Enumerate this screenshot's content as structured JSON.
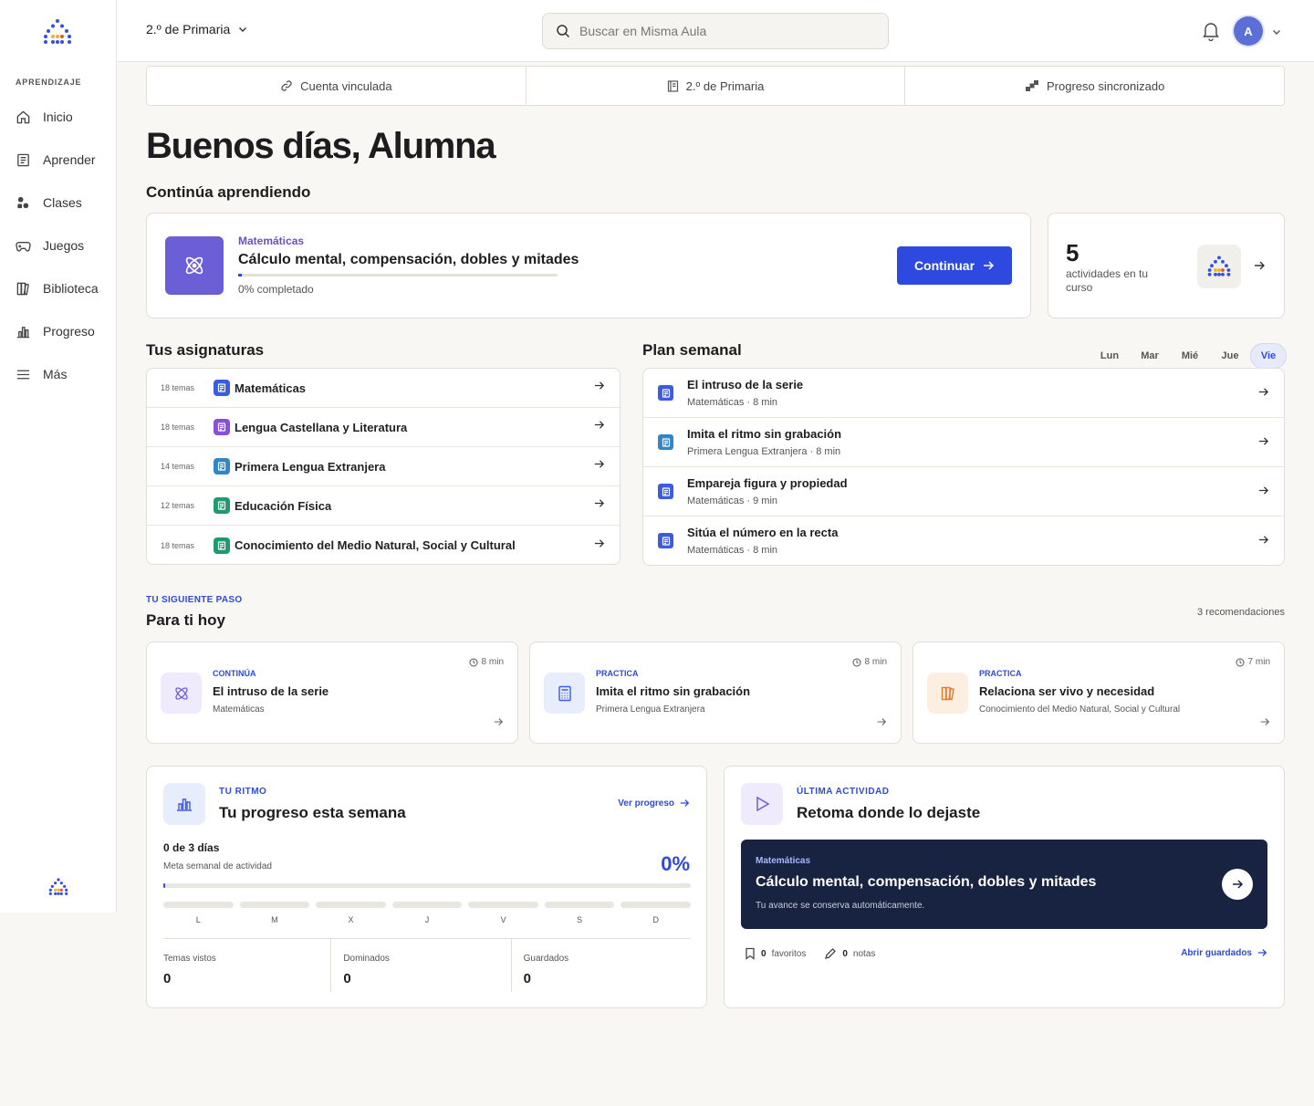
{
  "sidebar": {
    "section": "APRENDIZAJE",
    "items": [
      {
        "label": "Inicio",
        "icon": "home-icon"
      },
      {
        "label": "Aprender",
        "icon": "book-icon"
      },
      {
        "label": "Clases",
        "icon": "classes-icon"
      },
      {
        "label": "Juegos",
        "icon": "gamepad-icon"
      },
      {
        "label": "Biblioteca",
        "icon": "library-icon"
      },
      {
        "label": "Progreso",
        "icon": "bar-chart-icon"
      },
      {
        "label": "Más",
        "icon": "menu-icon"
      }
    ]
  },
  "header": {
    "grade": "2.º de Primaria",
    "search_placeholder": "Buscar en Misma Aula",
    "avatar_initial": "A"
  },
  "status": {
    "linked": "Cuenta vinculada",
    "grade": "2.º de Primaria",
    "synced": "Progreso sincronizado"
  },
  "greeting": "Buenos días, Alumna",
  "continue_section": {
    "heading": "Continúa aprendiendo",
    "subject": "Matemáticas",
    "title": "Cálculo mental, compensación, dobles y mitades",
    "progress_text": "0% completado",
    "progress_value": 0,
    "button": "Continuar"
  },
  "activities": {
    "count": "5",
    "label": "actividades en tu curso"
  },
  "subjects": {
    "heading": "Tus asignaturas",
    "items": [
      {
        "count": "18 temas",
        "name": "Matemáticas",
        "color": "#3b5be0"
      },
      {
        "count": "18 temas",
        "name": "Lengua Castellana y Literatura",
        "color": "#8a4fd8"
      },
      {
        "count": "14 temas",
        "name": "Primera Lengua Extranjera",
        "color": "#2f86c8"
      },
      {
        "count": "12 temas",
        "name": "Educación Física",
        "color": "#1f9a6e"
      },
      {
        "count": "18 temas",
        "name": "Conocimiento del Medio Natural, Social y Cultural",
        "color": "#1f9a6e"
      }
    ]
  },
  "plan": {
    "heading": "Plan semanal",
    "days": [
      "Lun",
      "Mar",
      "Mié",
      "Jue",
      "Vie"
    ],
    "active_day": "Vie",
    "items": [
      {
        "title": "El intruso de la serie",
        "meta": "Matemáticas · 8 min",
        "color": "#3b5be0"
      },
      {
        "title": "Imita el ritmo sin grabación",
        "meta": "Primera Lengua Extranjera · 8 min",
        "color": "#2f86c8"
      },
      {
        "title": "Empareja figura y propiedad",
        "meta": "Matemáticas · 9 min",
        "color": "#3b5be0"
      },
      {
        "title": "Sitúa el número en la recta",
        "meta": "Matemáticas · 8 min",
        "color": "#3b5be0"
      }
    ]
  },
  "next": {
    "eyebrow": "TU SIGUIENTE PASO",
    "heading": "Para ti hoy",
    "count": "3 recomendaciones",
    "items": [
      {
        "type": "CONTINÚA",
        "title": "El intruso de la serie",
        "subject": "Matemáticas",
        "time": "8 min",
        "bg": "#efeafc"
      },
      {
        "type": "PRACTICA",
        "title": "Imita el ritmo sin grabación",
        "subject": "Primera Lengua Extranjera",
        "time": "8 min",
        "bg": "#e8edfb"
      },
      {
        "type": "PRACTICA",
        "title": "Relaciona ser vivo y necesidad",
        "subject": "Conocimiento del Medio Natural, Social y Cultural",
        "time": "7 min",
        "bg": "#fdeee2"
      }
    ]
  },
  "rhythm": {
    "eyebrow": "TU RITMO",
    "title": "Tu progreso esta semana",
    "link": "Ver progreso",
    "days_text": "0 de 3 días",
    "meta": "Meta semanal de actividad",
    "pct": "0%",
    "pct_value": 0,
    "week": [
      "L",
      "M",
      "X",
      "J",
      "V",
      "S",
      "D"
    ],
    "stats": [
      {
        "label": "Temas vistos",
        "value": "0"
      },
      {
        "label": "Dominados",
        "value": "0"
      },
      {
        "label": "Guardados",
        "value": "0"
      }
    ]
  },
  "last": {
    "eyebrow": "ÚLTIMA ACTIVIDAD",
    "title": "Retoma donde lo dejaste",
    "subject": "Matemáticas",
    "activity": "Cálculo mental, compensación, dobles y mitades",
    "note": "Tu avance se conserva automáticamente.",
    "favorites_count": "0",
    "favorites_label": "favoritos",
    "notes_count": "0",
    "notes_label": "notas",
    "link": "Abrir guardados"
  },
  "colors": {
    "accent": "#2e49e0",
    "purple": "#6b5ed7",
    "dark": "#172340"
  }
}
